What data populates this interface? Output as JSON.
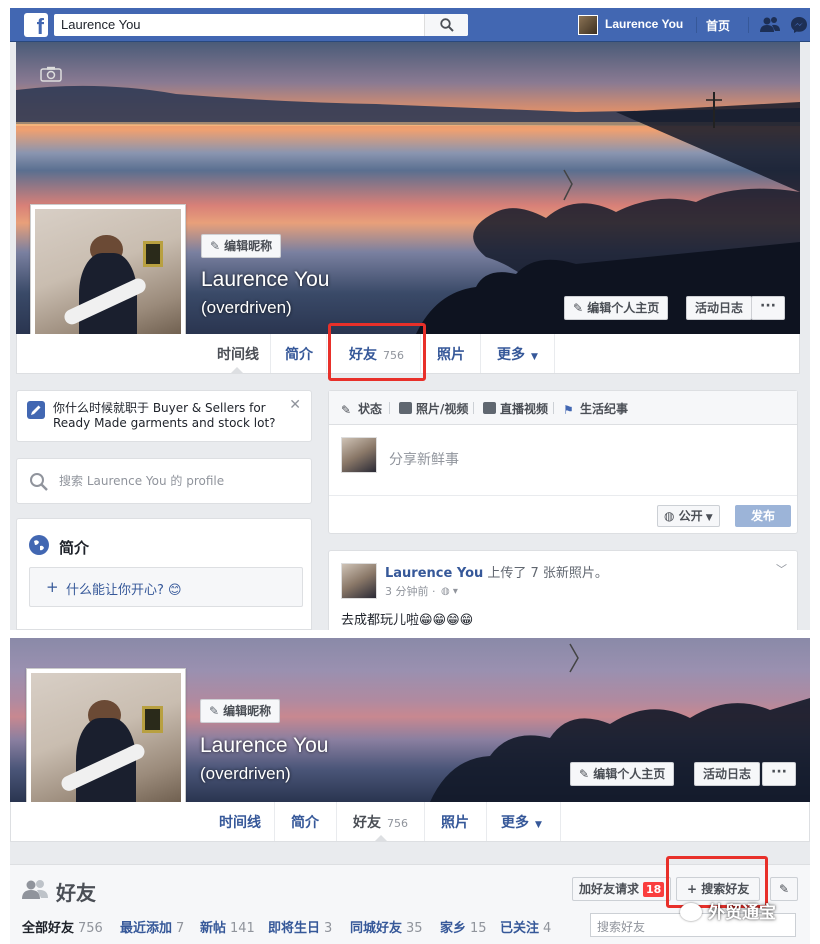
{
  "topbar": {
    "search_value": "Laurence You",
    "user_name": "Laurence You",
    "home_label": "首页"
  },
  "profile": {
    "edit_nickname": "编辑昵称",
    "name": "Laurence You",
    "alt_name": "(overdriven)",
    "edit_profile": "编辑个人主页",
    "activity_log": "活动日志",
    "more_dots": "···"
  },
  "nav": {
    "timeline": "时间线",
    "about": "简介",
    "friends": "好友",
    "friends_count": "756",
    "photos": "照片",
    "more": "更多"
  },
  "left": {
    "prompt_text": "你什么时候就职于 Buyer & Sellers for Ready Made garments and stock lot?",
    "search_placeholder": "搜索 Laurence You 的 profile",
    "intro_title": "简介",
    "intro_prompt": "什么能让你开心? 😊"
  },
  "composer": {
    "tab_status": "状态",
    "tab_photo": "照片/视频",
    "tab_live": "直播视频",
    "tab_life": "生活纪事",
    "placeholder": "分享新鲜事",
    "privacy": "公开",
    "post_btn": "发布"
  },
  "post": {
    "author": "Laurence You",
    "action": "上传了 7 张新照片。",
    "time": "3 分钟前 ·",
    "body": "去成都玩儿啦😁😁😁😁"
  },
  "friends_section": {
    "title": "好友",
    "friend_requests": "加好友请求",
    "requests_count": "18",
    "find_friends": "+ 搜索好友",
    "search_placeholder": "搜索好友",
    "filters": [
      {
        "label": "全部好友",
        "count": "756"
      },
      {
        "label": "最近添加",
        "count": "7"
      },
      {
        "label": "新帖",
        "count": "141"
      },
      {
        "label": "即将生日",
        "count": "3"
      },
      {
        "label": "同城好友",
        "count": "35"
      },
      {
        "label": "家乡",
        "count": "15"
      },
      {
        "label": "已关注",
        "count": "4"
      }
    ]
  },
  "watermark": "外贸通宝",
  "colors": {
    "fb_blue": "#4267b2",
    "link_blue": "#365899",
    "highlight_red": "#e8302a"
  }
}
